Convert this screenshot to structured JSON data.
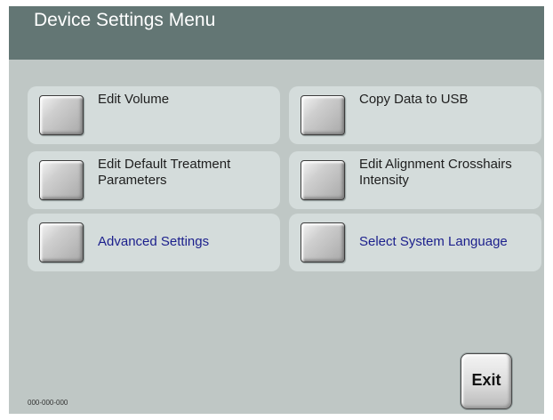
{
  "header": {
    "title": "Device Settings Menu"
  },
  "menu": {
    "edit_volume": "Edit Volume",
    "copy_data_usb": "Copy Data to USB",
    "edit_default_treatment_line1": "Edit Default Treatment",
    "edit_default_treatment_line2": "Parameters",
    "edit_alignment_line1": "Edit Alignment Crosshairs",
    "edit_alignment_line2": "Intensity",
    "advanced_settings": "Advanced Settings",
    "select_language": "Select System Language"
  },
  "footer": {
    "serial": "000-000-000",
    "exit_label": "Exit"
  },
  "colors": {
    "header_bg": "#637674",
    "body_bg": "#bfc7c5",
    "item_bg": "#d4dcdb",
    "link_text": "#1b1f8c"
  }
}
